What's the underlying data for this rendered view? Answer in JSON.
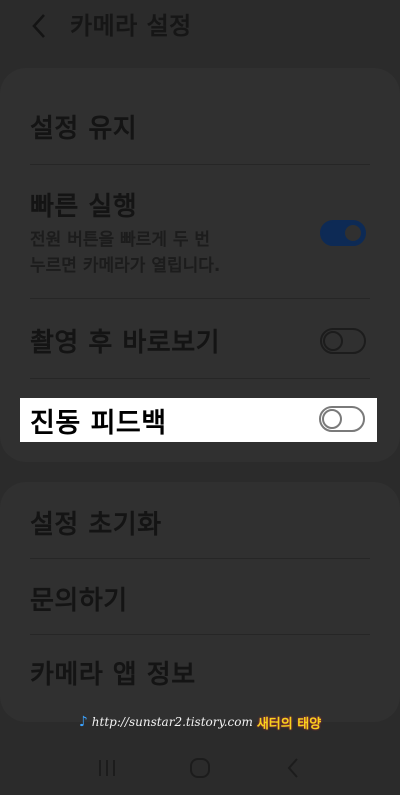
{
  "header": {
    "title": "카메라 설정",
    "back_icon": "chevron-left-icon"
  },
  "settings_group_1": {
    "items": [
      {
        "title": "설정 유지"
      },
      {
        "title": "빠른 실행",
        "subtitle_lines": [
          "전원 버튼을 빠르게 두 번",
          "누르면 카메라가 열립니다."
        ],
        "toggle": "on"
      },
      {
        "title": "촬영 후 바로보기",
        "toggle": "off"
      },
      {
        "title": "진동 피드백",
        "toggle": "off",
        "highlighted": true
      }
    ]
  },
  "settings_group_2": {
    "items": [
      {
        "title": "설정 초기화"
      },
      {
        "title": "문의하기"
      },
      {
        "title": "카메라 앱 정보"
      }
    ]
  },
  "watermark": {
    "url": "http://sunstar2.tistory.com",
    "brand": "새터의 태양"
  },
  "navbar": {
    "icons": [
      "recent-apps-icon",
      "home-icon",
      "back-icon"
    ]
  },
  "colors": {
    "background": "#2b2b2b",
    "card": "#303030",
    "toggle_on": "#0d2a55",
    "highlight": "#ffffff"
  }
}
